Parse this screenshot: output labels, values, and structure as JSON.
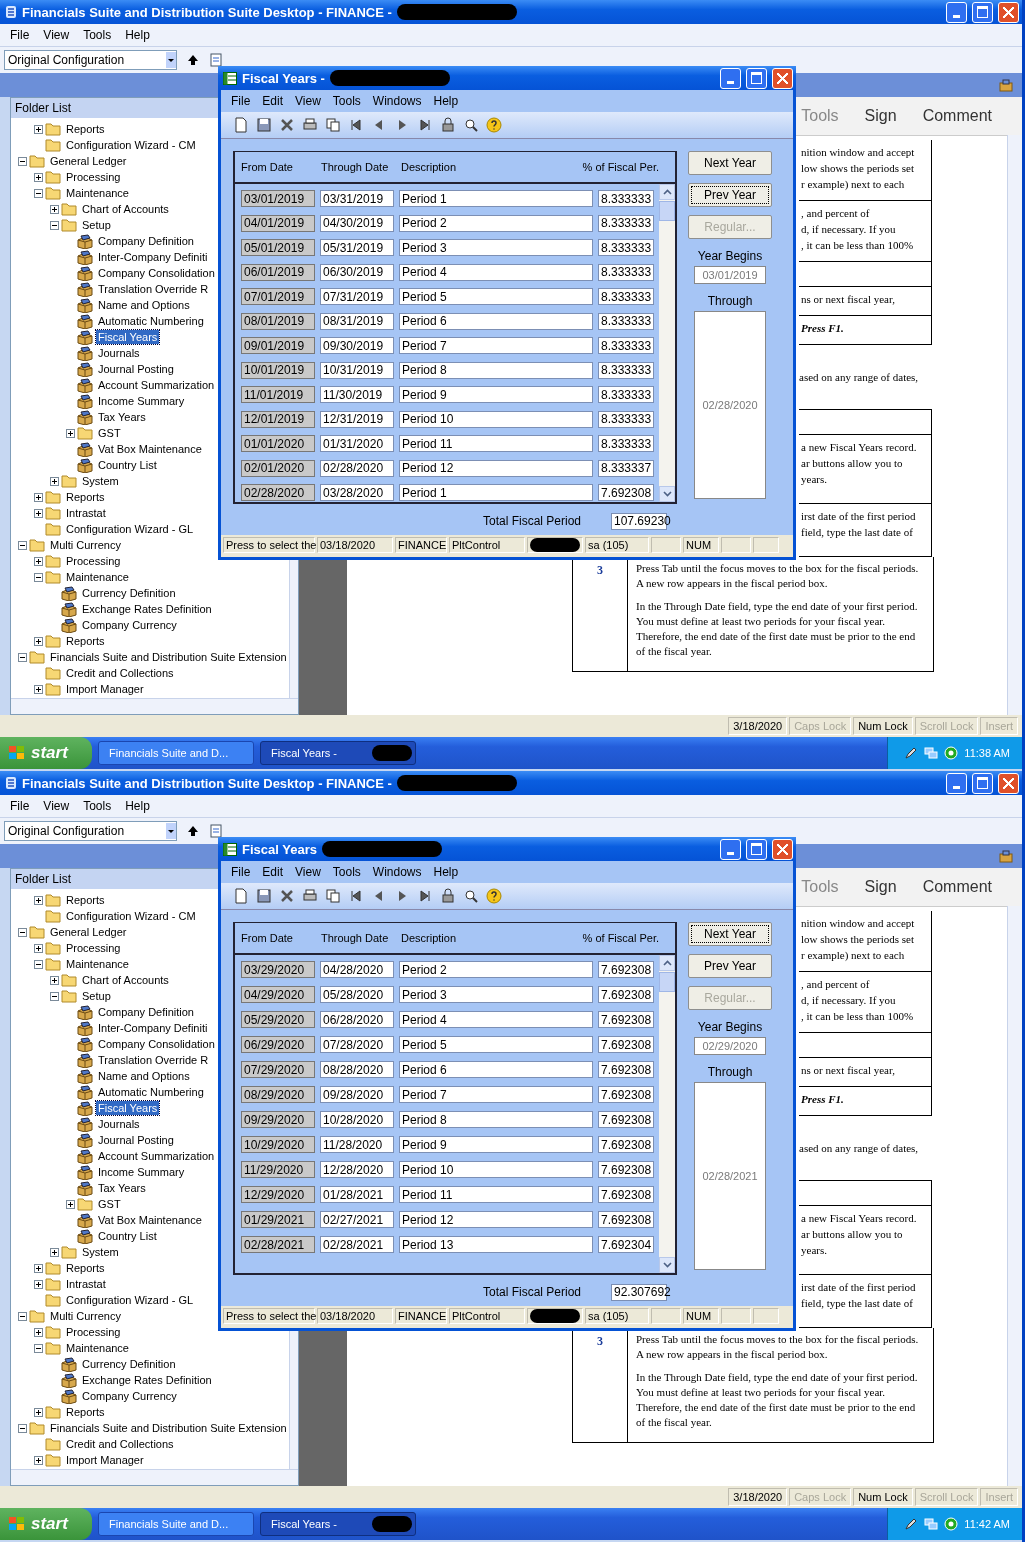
{
  "screens": [
    {
      "title": "Financials Suite and Distribution Suite Desktop -  FINANCE -",
      "menu": [
        "File",
        "View",
        "Tools",
        "Help"
      ],
      "configuration": "Original Configuration",
      "folder_list": {
        "title": "Folder List",
        "continued": [
          {
            "label": "Reports",
            "kind": "collapsed",
            "selected": false
          },
          {
            "label": "Configuration Wizard - CM",
            "kind": "folder",
            "selected": false
          }
        ],
        "items": [
          {
            "label": "General Ledger",
            "kind": "expanded",
            "selected": false,
            "children": [
              {
                "label": "Processing",
                "kind": "collapsed",
                "selected": false
              },
              {
                "label": "Maintenance",
                "kind": "expanded",
                "selected": false,
                "children": [
                  {
                    "label": "Chart of Accounts",
                    "kind": "collapsed",
                    "selected": false
                  },
                  {
                    "label": "Setup",
                    "kind": "expanded",
                    "selected": false,
                    "children": [
                      {
                        "label": "Company Definition",
                        "kind": "form",
                        "selected": false
                      },
                      {
                        "label": "Inter-Company Definiti",
                        "kind": "form",
                        "selected": false
                      },
                      {
                        "label": "Company Consolidation",
                        "kind": "form",
                        "selected": false
                      },
                      {
                        "label": "Translation Override R",
                        "kind": "form",
                        "selected": false
                      },
                      {
                        "label": "Name and Options",
                        "kind": "form",
                        "selected": false
                      },
                      {
                        "label": "Automatic Numbering",
                        "kind": "form",
                        "selected": false
                      },
                      {
                        "label": "Fiscal Years",
                        "kind": "form",
                        "selected": true
                      },
                      {
                        "label": "Journals",
                        "kind": "form",
                        "selected": false
                      },
                      {
                        "label": "Journal Posting",
                        "kind": "form",
                        "selected": false
                      },
                      {
                        "label": "Account Summarization",
                        "kind": "form",
                        "selected": false
                      },
                      {
                        "label": "Income Summary",
                        "kind": "form",
                        "selected": false
                      },
                      {
                        "label": "Tax Years",
                        "kind": "form",
                        "selected": false
                      },
                      {
                        "label": "GST",
                        "kind": "collapsed",
                        "selected": false
                      },
                      {
                        "label": "Vat Box Maintenance",
                        "kind": "form",
                        "selected": false
                      },
                      {
                        "label": "Country List",
                        "kind": "form",
                        "selected": false
                      }
                    ]
                  },
                  {
                    "label": "System",
                    "kind": "collapsed",
                    "selected": false
                  }
                ]
              },
              {
                "label": "Reports",
                "kind": "collapsed",
                "selected": false
              },
              {
                "label": "Intrastat",
                "kind": "collapsed",
                "selected": false
              },
              {
                "label": "Configuration Wizard - GL",
                "kind": "folder",
                "selected": false
              }
            ]
          },
          {
            "label": "Multi Currency",
            "kind": "expanded",
            "selected": false,
            "children": [
              {
                "label": "Processing",
                "kind": "collapsed",
                "selected": false
              },
              {
                "label": "Maintenance",
                "kind": "expanded",
                "selected": false,
                "children": [
                  {
                    "label": "Currency Definition",
                    "kind": "form",
                    "selected": false
                  },
                  {
                    "label": "Exchange Rates Definition",
                    "kind": "form",
                    "selected": false
                  },
                  {
                    "label": "Company Currency",
                    "kind": "form",
                    "selected": false
                  }
                ]
              },
              {
                "label": "Reports",
                "kind": "collapsed",
                "selected": false
              }
            ]
          },
          {
            "label": "Financials Suite and Distribution Suite Extension",
            "kind": "expanded",
            "selected": false,
            "children": [
              {
                "label": "Credit and Collections",
                "kind": "folder",
                "selected": false
              },
              {
                "label": "Import Manager",
                "kind": "collapsed",
                "selected": false
              }
            ]
          }
        ]
      },
      "doc": {
        "tabs": [
          "Tools",
          "Sign",
          "Comment"
        ],
        "upper_rows": [
          {
            "kind": "text",
            "lines": [
              "nition window and accept",
              "low shows the periods set",
              "r example) next to each"
            ]
          },
          {
            "kind": "text",
            "lines": [
              ", and percent of",
              "d, if necessary. If you",
              ", it can be less than 100%"
            ]
          },
          {
            "kind": "blank"
          },
          {
            "kind": "text",
            "lines": [
              "ns or next fiscal year,"
            ]
          },
          {
            "kind": "emphasis",
            "lines": [
              "Press F1."
            ]
          }
        ],
        "note": "ased on any range of dates,",
        "lower_rows": [
          {
            "kind": "blank"
          },
          {
            "kind": "text",
            "lines": [
              "a new Fiscal Years record.",
              "ar buttons allow you to",
              "years."
            ]
          },
          {
            "kind": "text",
            "lines": [
              "irst date of the first period",
              "field, type the last date of"
            ]
          }
        ],
        "step": {
          "number": "3",
          "paragraphs": [
            "Press Tab until the focus moves to the box for the fiscal periods. A new row appears in the fiscal period box.",
            "In the Through Date field, type the end date of your first period. You must define at least two periods for your fiscal year. Therefore, the end date of the first date must be prior to the end of the fiscal year."
          ]
        }
      },
      "dialog": {
        "title": "Fiscal Years -",
        "menu": [
          "File",
          "Edit",
          "View",
          "Tools",
          "Windows",
          "Help"
        ],
        "columns": [
          "From Date",
          "Through Date",
          "Description",
          "% of Fiscal Per."
        ],
        "rows": [
          {
            "from": "03/01/2019",
            "through": "03/31/2019",
            "description": "Period 1",
            "percent": "8.333333"
          },
          {
            "from": "04/01/2019",
            "through": "04/30/2019",
            "description": "Period 2",
            "percent": "8.333333"
          },
          {
            "from": "05/01/2019",
            "through": "05/31/2019",
            "description": "Period 3",
            "percent": "8.333333"
          },
          {
            "from": "06/01/2019",
            "through": "06/30/2019",
            "description": "Period 4",
            "percent": "8.333333"
          },
          {
            "from": "07/01/2019",
            "through": "07/31/2019",
            "description": "Period 5",
            "percent": "8.333333"
          },
          {
            "from": "08/01/2019",
            "through": "08/31/2019",
            "description": "Period 6",
            "percent": "8.333333"
          },
          {
            "from": "09/01/2019",
            "through": "09/30/2019",
            "description": "Period 7",
            "percent": "8.333333"
          },
          {
            "from": "10/01/2019",
            "through": "10/31/2019",
            "description": "Period 8",
            "percent": "8.333333"
          },
          {
            "from": "11/01/2019",
            "through": "11/30/2019",
            "description": "Period 9",
            "percent": "8.333333"
          },
          {
            "from": "12/01/2019",
            "through": "12/31/2019",
            "description": "Period 10",
            "percent": "8.333333"
          },
          {
            "from": "01/01/2020",
            "through": "01/31/2020",
            "description": "Period 11",
            "percent": "8.333333"
          },
          {
            "from": "02/01/2020",
            "through": "02/28/2020",
            "description": "Period 12",
            "percent": "8.333337"
          },
          {
            "from": "02/28/2020",
            "through": "03/28/2020",
            "description": "Period 1",
            "percent": "7.692308"
          }
        ],
        "buttons": [
          {
            "label": "Next Year",
            "focused": false,
            "disabled": false
          },
          {
            "label": "Prev Year",
            "focused": true,
            "disabled": false
          },
          {
            "label": "Regular...",
            "focused": false,
            "disabled": true
          }
        ],
        "year_begins_label": "Year Begins",
        "year_begins": "03/01/2019",
        "through_label": "Through",
        "through": "02/28/2020",
        "total_label": "Total Fiscal Period",
        "total": "107.69230",
        "status": [
          {
            "kind": "text",
            "text": "Press to select the"
          },
          {
            "kind": "text",
            "text": "03/18/2020"
          },
          {
            "kind": "text",
            "text": "FINANCE"
          },
          {
            "kind": "text",
            "text": "PltControl"
          },
          {
            "kind": "redacted"
          },
          {
            "kind": "text",
            "text": "sa (105)"
          },
          {
            "kind": "empty"
          },
          {
            "kind": "text",
            "text": "NUM"
          },
          {
            "kind": "empty"
          },
          {
            "kind": "empty"
          }
        ]
      },
      "status": [
        {
          "text": "3/18/2020",
          "active": true
        },
        {
          "text": "Caps Lock",
          "active": false
        },
        {
          "text": "Num Lock",
          "active": true
        },
        {
          "text": "Scroll Lock",
          "active": false
        },
        {
          "text": "Insert",
          "active": false
        }
      ],
      "taskbar": {
        "start": "start",
        "buttons": [
          {
            "label": "Financials Suite and D...",
            "selected": false
          },
          {
            "label": "Fiscal Years -",
            "selected": true
          }
        ],
        "time": "11:38 AM"
      }
    },
    {
      "title": "Financials Suite and Distribution Suite Desktop -  FINANCE -",
      "menu": [
        "File",
        "View",
        "Tools",
        "Help"
      ],
      "configuration": "Original Configuration",
      "folder_list": {
        "title": "Folder List",
        "continued": [
          {
            "label": "Reports",
            "kind": "collapsed",
            "selected": false
          },
          {
            "label": "Configuration Wizard - CM",
            "kind": "folder",
            "selected": false
          }
        ],
        "items": [
          {
            "label": "General Ledger",
            "kind": "expanded",
            "selected": false,
            "children": [
              {
                "label": "Processing",
                "kind": "collapsed",
                "selected": false
              },
              {
                "label": "Maintenance",
                "kind": "expanded",
                "selected": false,
                "children": [
                  {
                    "label": "Chart of Accounts",
                    "kind": "collapsed",
                    "selected": false
                  },
                  {
                    "label": "Setup",
                    "kind": "expanded",
                    "selected": false,
                    "children": [
                      {
                        "label": "Company Definition",
                        "kind": "form",
                        "selected": false
                      },
                      {
                        "label": "Inter-Company Definiti",
                        "kind": "form",
                        "selected": false
                      },
                      {
                        "label": "Company Consolidation",
                        "kind": "form",
                        "selected": false
                      },
                      {
                        "label": "Translation Override R",
                        "kind": "form",
                        "selected": false
                      },
                      {
                        "label": "Name and Options",
                        "kind": "form",
                        "selected": false
                      },
                      {
                        "label": "Automatic Numbering",
                        "kind": "form",
                        "selected": false
                      },
                      {
                        "label": "Fiscal Years",
                        "kind": "form",
                        "selected": true
                      },
                      {
                        "label": "Journals",
                        "kind": "form",
                        "selected": false
                      },
                      {
                        "label": "Journal Posting",
                        "kind": "form",
                        "selected": false
                      },
                      {
                        "label": "Account Summarization",
                        "kind": "form",
                        "selected": false
                      },
                      {
                        "label": "Income Summary",
                        "kind": "form",
                        "selected": false
                      },
                      {
                        "label": "Tax Years",
                        "kind": "form",
                        "selected": false
                      },
                      {
                        "label": "GST",
                        "kind": "collapsed",
                        "selected": false
                      },
                      {
                        "label": "Vat Box Maintenance",
                        "kind": "form",
                        "selected": false
                      },
                      {
                        "label": "Country List",
                        "kind": "form",
                        "selected": false
                      }
                    ]
                  },
                  {
                    "label": "System",
                    "kind": "collapsed",
                    "selected": false
                  }
                ]
              },
              {
                "label": "Reports",
                "kind": "collapsed",
                "selected": false
              },
              {
                "label": "Intrastat",
                "kind": "collapsed",
                "selected": false
              },
              {
                "label": "Configuration Wizard - GL",
                "kind": "folder",
                "selected": false
              }
            ]
          },
          {
            "label": "Multi Currency",
            "kind": "expanded",
            "selected": false,
            "children": [
              {
                "label": "Processing",
                "kind": "collapsed",
                "selected": false
              },
              {
                "label": "Maintenance",
                "kind": "expanded",
                "selected": false,
                "children": [
                  {
                    "label": "Currency Definition",
                    "kind": "form",
                    "selected": false
                  },
                  {
                    "label": "Exchange Rates Definition",
                    "kind": "form",
                    "selected": false
                  },
                  {
                    "label": "Company Currency",
                    "kind": "form",
                    "selected": false
                  }
                ]
              },
              {
                "label": "Reports",
                "kind": "collapsed",
                "selected": false
              }
            ]
          },
          {
            "label": "Financials Suite and Distribution Suite Extension",
            "kind": "expanded",
            "selected": false,
            "children": [
              {
                "label": "Credit and Collections",
                "kind": "folder",
                "selected": false
              },
              {
                "label": "Import Manager",
                "kind": "collapsed",
                "selected": false
              }
            ]
          }
        ]
      },
      "doc": {
        "tabs": [
          "Tools",
          "Sign",
          "Comment"
        ],
        "upper_rows": [
          {
            "kind": "text",
            "lines": [
              "nition window and accept",
              "low shows the periods set",
              "r example) next to each"
            ]
          },
          {
            "kind": "text",
            "lines": [
              ", and percent of",
              "d, if necessary. If you",
              ", it can be less than 100%"
            ]
          },
          {
            "kind": "blank"
          },
          {
            "kind": "text",
            "lines": [
              "ns or next fiscal year,"
            ]
          },
          {
            "kind": "emphasis",
            "lines": [
              "Press F1."
            ]
          }
        ],
        "note": "ased on any range of dates,",
        "lower_rows": [
          {
            "kind": "blank"
          },
          {
            "kind": "text",
            "lines": [
              "a new Fiscal Years record.",
              "ar buttons allow you to",
              "years."
            ]
          },
          {
            "kind": "text",
            "lines": [
              "irst date of the first period",
              "field, type the last date of"
            ]
          }
        ],
        "step": {
          "number": "3",
          "paragraphs": [
            "Press Tab until the focus moves to the box for the fiscal periods. A new row appears in the fiscal period box.",
            "In the Through Date field, type the end date of your first period. You must define at least two periods for your fiscal year. Therefore, the end date of the first date must be prior to the end of the fiscal year."
          ]
        }
      },
      "dialog": {
        "title": "Fiscal Years",
        "menu": [
          "File",
          "Edit",
          "View",
          "Tools",
          "Windows",
          "Help"
        ],
        "columns": [
          "From Date",
          "Through Date",
          "Description",
          "% of Fiscal Per."
        ],
        "rows": [
          {
            "from": "03/29/2020",
            "through": "04/28/2020",
            "description": "Period 2",
            "percent": "7.692308"
          },
          {
            "from": "04/29/2020",
            "through": "05/28/2020",
            "description": "Period 3",
            "percent": "7.692308"
          },
          {
            "from": "05/29/2020",
            "through": "06/28/2020",
            "description": "Period 4",
            "percent": "7.692308"
          },
          {
            "from": "06/29/2020",
            "through": "07/28/2020",
            "description": "Period 5",
            "percent": "7.692308"
          },
          {
            "from": "07/29/2020",
            "through": "08/28/2020",
            "description": "Period 6",
            "percent": "7.692308"
          },
          {
            "from": "08/29/2020",
            "through": "09/28/2020",
            "description": "Period 7",
            "percent": "7.692308"
          },
          {
            "from": "09/29/2020",
            "through": "10/28/2020",
            "description": "Period 8",
            "percent": "7.692308"
          },
          {
            "from": "10/29/2020",
            "through": "11/28/2020",
            "description": "Period 9",
            "percent": "7.692308"
          },
          {
            "from": "11/29/2020",
            "through": "12/28/2020",
            "description": "Period 10",
            "percent": "7.692308"
          },
          {
            "from": "12/29/2020",
            "through": "01/28/2021",
            "description": "Period 11",
            "percent": "7.692308"
          },
          {
            "from": "01/29/2021",
            "through": "02/27/2021",
            "description": "Period 12",
            "percent": "7.692308"
          },
          {
            "from": "02/28/2021",
            "through": "02/28/2021",
            "description": "Period 13",
            "percent": "7.692304"
          }
        ],
        "buttons": [
          {
            "label": "Next Year",
            "focused": true,
            "disabled": false
          },
          {
            "label": "Prev Year",
            "focused": false,
            "disabled": false
          },
          {
            "label": "Regular...",
            "focused": false,
            "disabled": true
          }
        ],
        "year_begins_label": "Year Begins",
        "year_begins": "02/29/2020",
        "through_label": "Through",
        "through": "02/28/2021",
        "total_label": "Total Fiscal Period",
        "total": "92.307692",
        "status": [
          {
            "kind": "text",
            "text": "Press to select the"
          },
          {
            "kind": "text",
            "text": "03/18/2020"
          },
          {
            "kind": "text",
            "text": "FINANCE"
          },
          {
            "kind": "text",
            "text": "PltControl"
          },
          {
            "kind": "redacted"
          },
          {
            "kind": "text",
            "text": "sa (105)"
          },
          {
            "kind": "empty"
          },
          {
            "kind": "text",
            "text": "NUM"
          },
          {
            "kind": "empty"
          },
          {
            "kind": "empty"
          }
        ]
      },
      "status": [
        {
          "text": "3/18/2020",
          "active": true
        },
        {
          "text": "Caps Lock",
          "active": false
        },
        {
          "text": "Num Lock",
          "active": true
        },
        {
          "text": "Scroll Lock",
          "active": false
        },
        {
          "text": "Insert",
          "active": false
        }
      ],
      "taskbar": {
        "start": "start",
        "buttons": [
          {
            "label": "Financials Suite and D...",
            "selected": false
          },
          {
            "label": "Fiscal Years -",
            "selected": true
          }
        ],
        "time": "11:42 AM"
      }
    }
  ]
}
